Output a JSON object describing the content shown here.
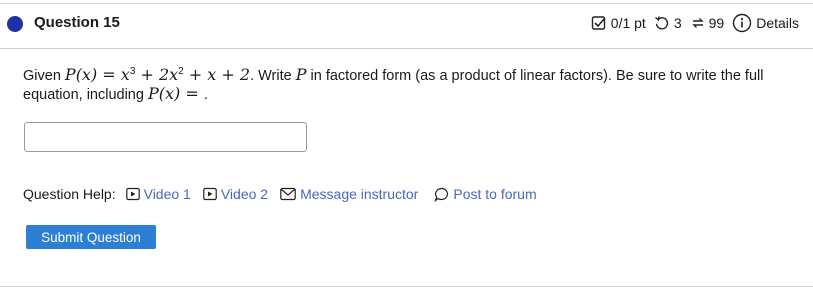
{
  "question": {
    "title": "Question 15",
    "score": "0/1 pt",
    "attempts": "3",
    "retries": "99",
    "details_label": "Details"
  },
  "prompt": {
    "given": "Given ",
    "func": "P(x)",
    "eq": " = ",
    "poly_t1": "x",
    "poly_t1_exp": "3",
    "poly_t2": " + 2x",
    "poly_t2_exp": "2",
    "poly_t3": " + x + 2",
    "after_poly": ". Write ",
    "var_p": "P",
    "instruction": " in factored form (as a product of linear factors). Be sure to write the full equation, including ",
    "func2": "P(x)",
    "eq2": " = ",
    "end": "."
  },
  "answer_input": {
    "value": "",
    "placeholder": ""
  },
  "help": {
    "label": "Question Help:",
    "video1": "Video 1",
    "video2": "Video 2",
    "message": "Message instructor",
    "forum": "Post to forum"
  },
  "submit_label": "Submit Question",
  "colors": {
    "link": "#4a68b8",
    "button": "#2c7fd2",
    "dot": "#1f2fa8"
  }
}
